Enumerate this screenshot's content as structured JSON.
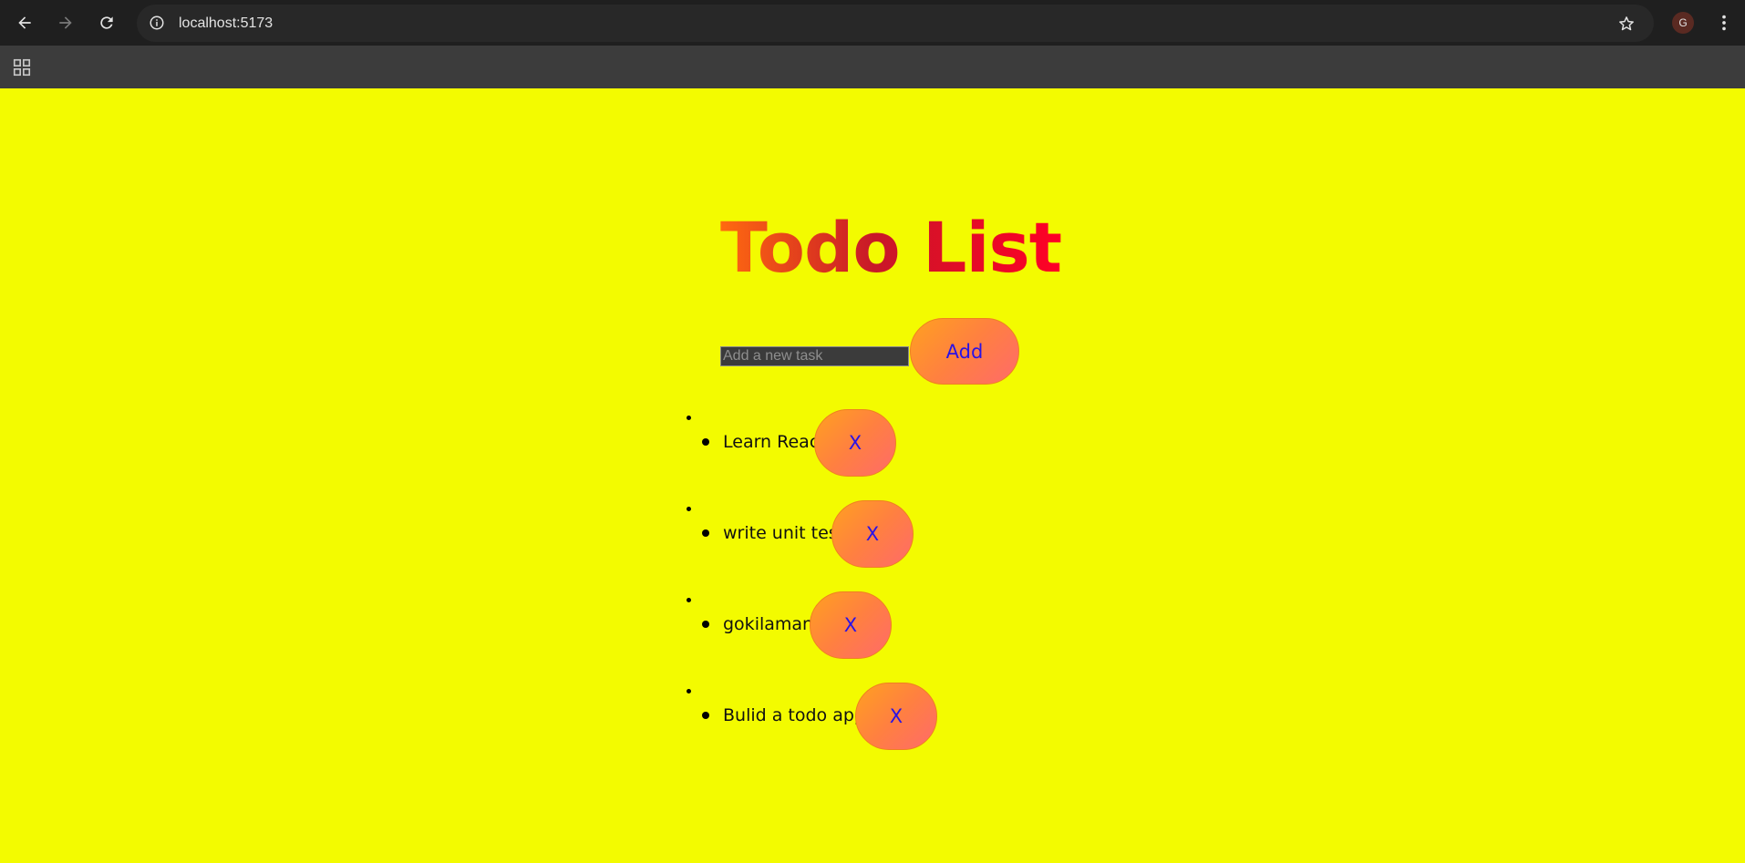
{
  "browser": {
    "url": "localhost:5173",
    "profile_initial": "G",
    "icons": {
      "back": "arrow-left-icon",
      "forward": "arrow-right-icon",
      "reload": "reload-icon",
      "site_info": "info-icon",
      "bookmark": "star-icon",
      "menu": "more-vert-icon",
      "apps": "apps-grid-icon"
    }
  },
  "app": {
    "title": "Todo List",
    "input": {
      "placeholder": "Add a new task",
      "value": ""
    },
    "add_label": "Add",
    "delete_label": "X",
    "tasks": [
      {
        "text": "Learn React"
      },
      {
        "text": "write unit test"
      },
      {
        "text": "gokilamani"
      },
      {
        "text": "Bulid a todo app"
      }
    ]
  },
  "colors": {
    "page_background": "#f3fb00",
    "title_gradient_start": "#ff6a10",
    "title_gradient_end": "#ff0026",
    "button_gradient_start": "#ffa020",
    "button_gradient_end": "#ff6a6a",
    "button_text": "#2a12e6"
  }
}
